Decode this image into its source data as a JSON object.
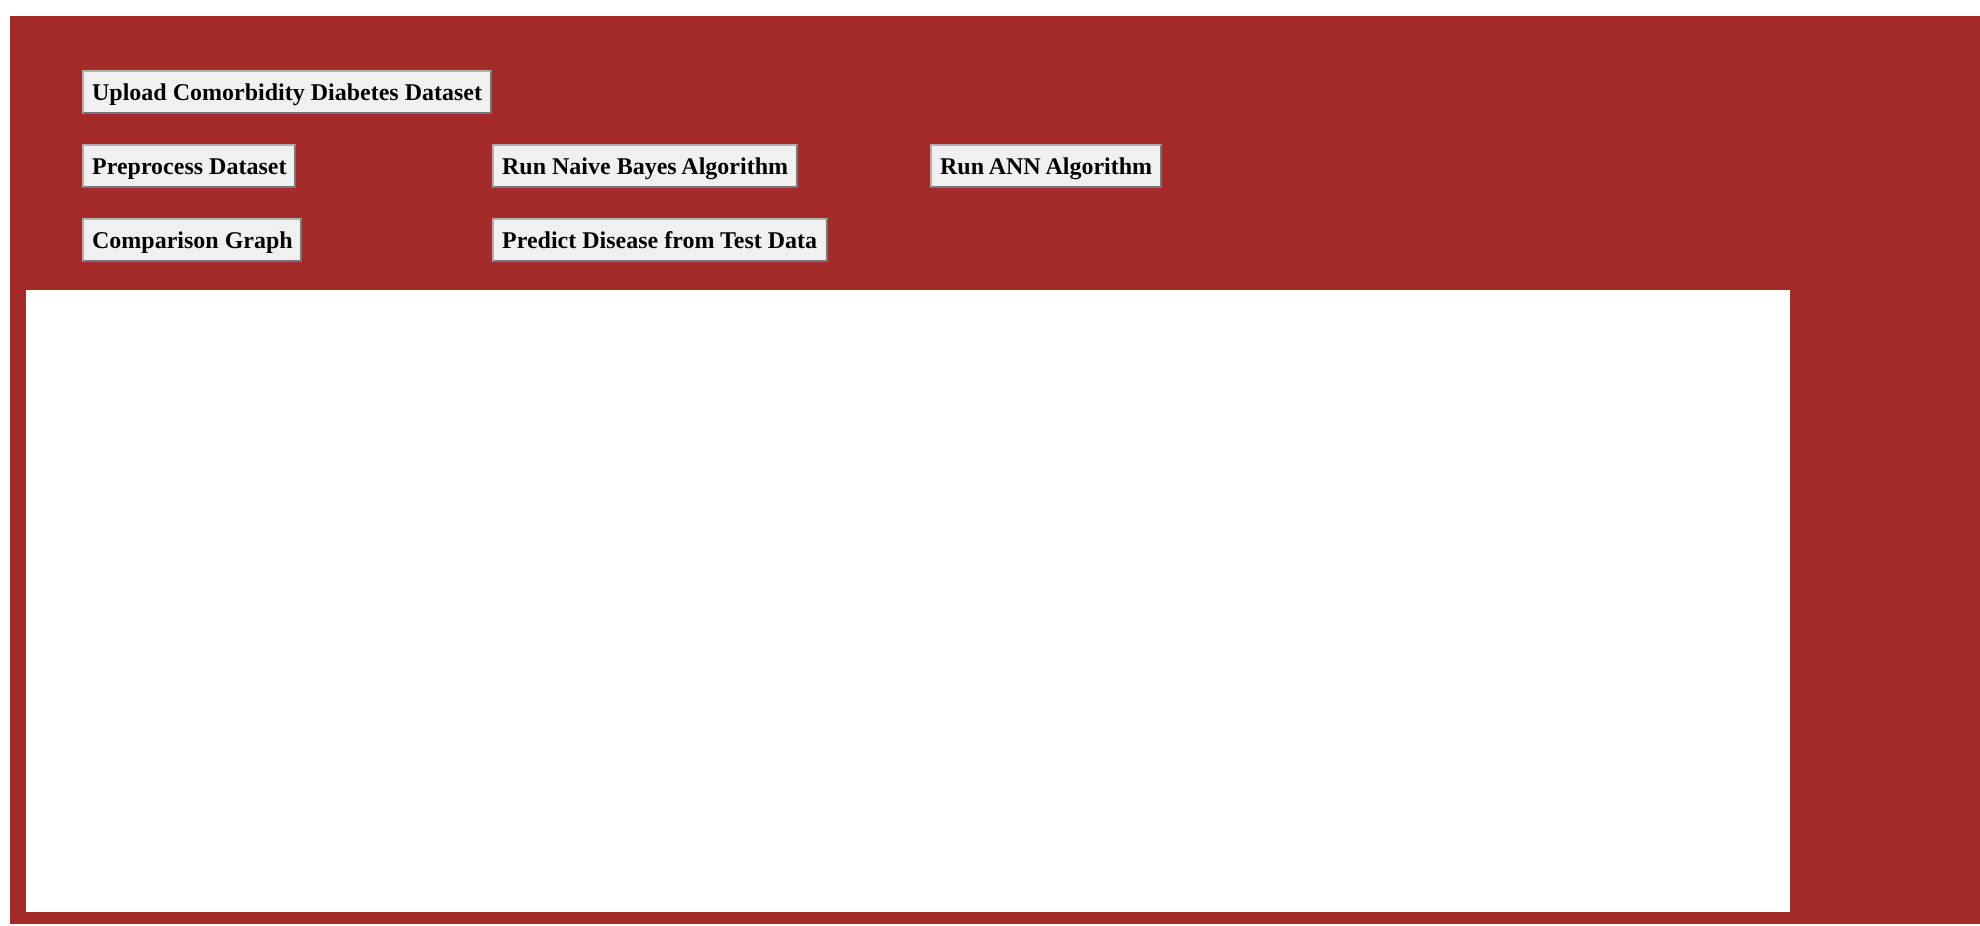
{
  "button_rows": [
    [
      "Upload Comorbidity Diabetes Dataset"
    ],
    [
      "Preprocess Dataset",
      "Run Naive Bayes Algorithm",
      "Run ANN Algorithm"
    ],
    [
      "Comparison Graph",
      "Predict Disease from Test Data"
    ]
  ]
}
